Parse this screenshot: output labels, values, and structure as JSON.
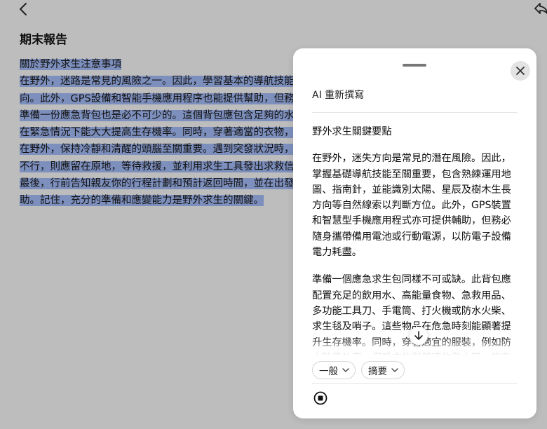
{
  "document": {
    "title": "期末報告",
    "lines": [
      "關於野外求生注意事項",
      "在野外，迷路是常見的風險之一。因此，學習基本的導航技能至關重要，包括使用地圖、指南針，以及利用",
      "向。此外，GPS設備和智能手機應用程序也能提供幫助，但務必確保攜帶足夠的電池或行動電源，以防電量",
      "準備一份應急背包也是必不可少的。這個背包應包含足夠的水、高能量食物、急救用品、多功能工具、手",
      "在緊急情況下能大大提高生存機率。同時，穿著適當的衣物，如防水外套、保暖層和舒適的徒步鞋，能有",
      "在野外，保持冷靜和清醒的頭腦至關重要。遇到突發狀況時，應先評估情況，再做出決定。如果迷路，應先",
      "不行，則應留在原地，等待救援，並利用求生工具發出求救信號，如哨子或反光鏡。",
      "最後，行前告知親友你的行程計劃和預計返回時間，並在出發前檢查天氣預報，確保安全，並做好充分準備以",
      "助。記住，充分的準備和應變能力是野外求生的關鍵。"
    ]
  },
  "panel": {
    "title": "AI 重新撰寫",
    "heading": "野外求生關鍵要點",
    "paragraphs": [
      "在野外，迷失方向是常見的潛在風險。因此，掌握基礎導航技能至關重要，包含熟練運用地圖、指南針，並能識別太陽、星辰及樹木生長方向等自然線索以判斷方位。此外，GPS裝置和智慧型手機應用程式亦可提供輔助，但務必隨身攜帶備用電池或行動電源，以防電子設備電力耗盡。",
      "準備一個應急求生包同樣不可或缺。此背包應配置充足的飲用水、高能量食物、急救用品、多功能工具刀、手電筒、打火機或防水火柴、求生毯及哨子。這些物品在危急時刻能顯著提升生存機率。同時，穿著適宜的服裝，例如防水防風外套、保暖衣物與舒適的登山鞋，能有效應對野外多變的氣候條件。"
    ],
    "tone_label": "一般",
    "format_label": "摘要"
  },
  "colors": {
    "background": "#bdbdbd",
    "highlight": "#7d8fbd",
    "panel": "#ffffff"
  },
  "icons": [
    "back-arrow-icon",
    "share-icon",
    "close-icon",
    "arrow-down-icon",
    "chevron-down-icon",
    "stop-icon"
  ]
}
